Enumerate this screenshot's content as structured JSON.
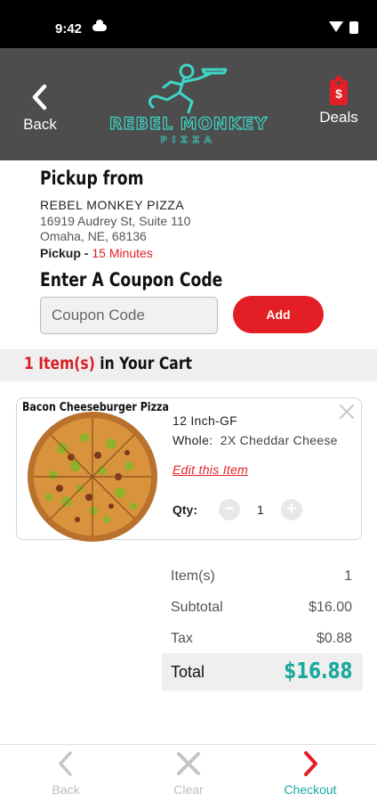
{
  "status_bar": {
    "time": "9:42"
  },
  "header": {
    "back_label": "Back",
    "brand_name": "REBEL MONKEY",
    "brand_sub": "PIZZA",
    "deals_label": "Deals",
    "deals_icon_glyph": "$",
    "background_color": "#4d4d4d",
    "accent_color": "#3ed6c8"
  },
  "pickup": {
    "title": "Pickup from",
    "store_name": "REBEL MONKEY PIZZA",
    "address_line1": "16919 Audrey St, Suite 110",
    "address_line2": "Omaha, NE, 68136",
    "time_label": "Pickup - ",
    "time_value": "15 Minutes"
  },
  "coupon": {
    "title": "Enter A Coupon Code",
    "placeholder": "Coupon Code",
    "value": "",
    "add_label": "Add"
  },
  "cart": {
    "count_text": "1 Item(s)",
    "title_rest": " in Your Cart"
  },
  "item": {
    "name": "Bacon Cheeseburger Pizza",
    "size": "12 Inch-GF",
    "whole_label": "Whole:",
    "whole_value": "2X Cheddar Cheese",
    "edit_label": "Edit this Item",
    "qty_label": "Qty:",
    "qty_value": "1",
    "minus_glyph": "−",
    "plus_glyph": "+",
    "close_icon": "close-icon"
  },
  "summary": {
    "items_label": "Item(s)",
    "items_value": "1",
    "subtotal_label": "Subtotal",
    "subtotal_value": "$16.00",
    "tax_label": "Tax",
    "tax_value": "$0.88",
    "total_label": "Total",
    "total_value": "$16.88"
  },
  "bottom_nav": {
    "back_label": "Back",
    "clear_label": "Clear",
    "checkout_label": "Checkout"
  },
  "colors": {
    "red": "#e31e24",
    "teal": "#1aa99e",
    "disabled": "#bdbdbd"
  }
}
